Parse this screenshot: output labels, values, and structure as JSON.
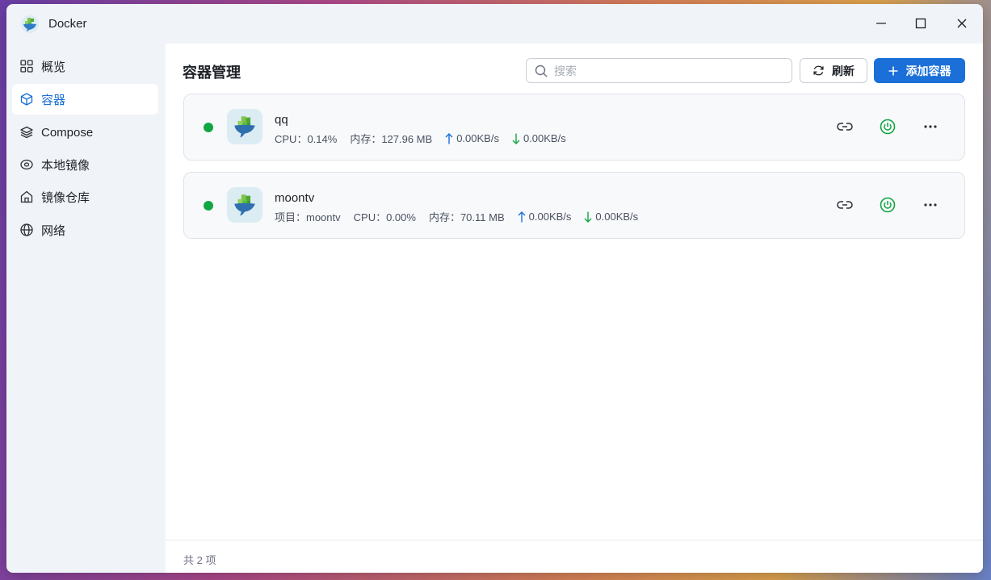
{
  "window": {
    "title": "Docker"
  },
  "sidebar": {
    "items": [
      {
        "label": "概览",
        "icon": "grid-icon"
      },
      {
        "label": "容器",
        "icon": "cube-icon",
        "active": true
      },
      {
        "label": "Compose",
        "icon": "layers-icon"
      },
      {
        "label": "本地镜像",
        "icon": "disk-icon"
      },
      {
        "label": "镜像仓库",
        "icon": "home-icon"
      },
      {
        "label": "网络",
        "icon": "globe-icon"
      }
    ]
  },
  "header": {
    "title": "容器管理",
    "search_placeholder": "搜索",
    "refresh_label": "刷新",
    "add_label": "添加容器"
  },
  "containers": [
    {
      "name": "qq",
      "status": "running",
      "project_label": "",
      "project": "",
      "cpu": "CPU：0.14%",
      "memory": "内存：127.96 MB",
      "upload": "0.00KB/s",
      "download": "0.00KB/s"
    },
    {
      "name": "moontv",
      "status": "running",
      "project": "项目：moontv",
      "cpu": "CPU：0.00%",
      "memory": "内存：70.11 MB",
      "upload": "0.00KB/s",
      "download": "0.00KB/s"
    }
  ],
  "footer": {
    "count_text": "共 2 项"
  },
  "colors": {
    "accent": "#1a6fd8",
    "running": "#11a544",
    "download_arrow": "#11a544",
    "upload_arrow": "#1a6fd8"
  }
}
